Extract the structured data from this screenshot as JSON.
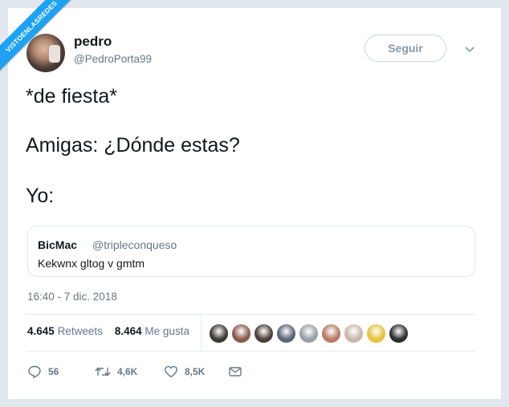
{
  "watermark": {
    "text": "VISTOENLASREDES"
  },
  "user": {
    "display_name": "pedro",
    "handle": "@PedroPorta99"
  },
  "follow_button": {
    "label": "Seguir"
  },
  "tweet": {
    "lines": [
      "*de fiesta*",
      "Amigas: ¿Dónde estas?",
      "Yo:"
    ]
  },
  "quoted_tweet": {
    "display_name": "BicMac",
    "handle": "@tripleconqueso",
    "text": "Kekwnx gltog v gmtm"
  },
  "timestamp": "16:40 - 7 dic. 2018",
  "stats": {
    "retweets_count": "4.645",
    "retweets_label": "Retweets",
    "likes_count": "8.464",
    "likes_label": "Me gusta"
  },
  "liker_avatar_colors": [
    "#3b3835",
    "#8a5a4a",
    "#4a4039",
    "#5a6678",
    "#9aa0a6",
    "#b87a62",
    "#c9b7a8",
    "#e8c23a",
    "#2e2e2e"
  ],
  "actions": {
    "reply_count": "56",
    "retweet_count": "4,6K",
    "like_count": "8,5K"
  },
  "colors": {
    "accent": "#1da1f2",
    "secondary_text": "#657786",
    "border": "#e1e8ed"
  },
  "icons": [
    "chevron-down-icon",
    "reply-icon",
    "retweet-icon",
    "heart-icon",
    "message-icon"
  ]
}
